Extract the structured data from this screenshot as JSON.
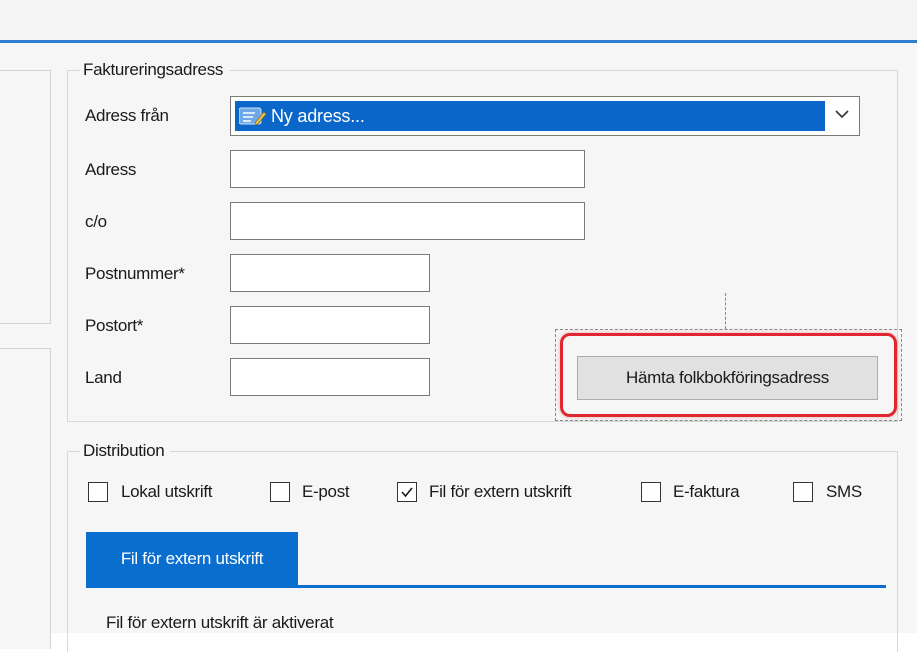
{
  "faktureringsadress": {
    "title": "Faktureringsadress",
    "adress_fran": {
      "label": "Adress från",
      "selected": "Ny adress..."
    },
    "adress": {
      "label": "Adress",
      "value": ""
    },
    "co": {
      "label": "c/o",
      "value": ""
    },
    "postnummer": {
      "label": "Postnummer*",
      "value": ""
    },
    "postort": {
      "label": "Postort*",
      "value": ""
    },
    "land": {
      "label": "Land",
      "value": ""
    },
    "fetch_button": "Hämta folkbokföringsadress"
  },
  "distribution": {
    "title": "Distribution",
    "options": [
      {
        "label": "Lokal utskrift",
        "checked": false
      },
      {
        "label": "E-post",
        "checked": false
      },
      {
        "label": "Fil för extern utskrift",
        "checked": true
      },
      {
        "label": "E-faktura",
        "checked": false
      },
      {
        "label": "SMS",
        "checked": false
      }
    ],
    "active_tab": "Fil för extern utskrift",
    "status_text": "Fil för extern utskrift är aktiverat"
  },
  "colors": {
    "accent_blue": "#0a6ecf",
    "highlight_red": "#e0262e"
  },
  "icons": {
    "combo_item": "edit-note-icon",
    "dropdown": "chevron-down-icon",
    "checkmark": "checkmark-icon"
  }
}
